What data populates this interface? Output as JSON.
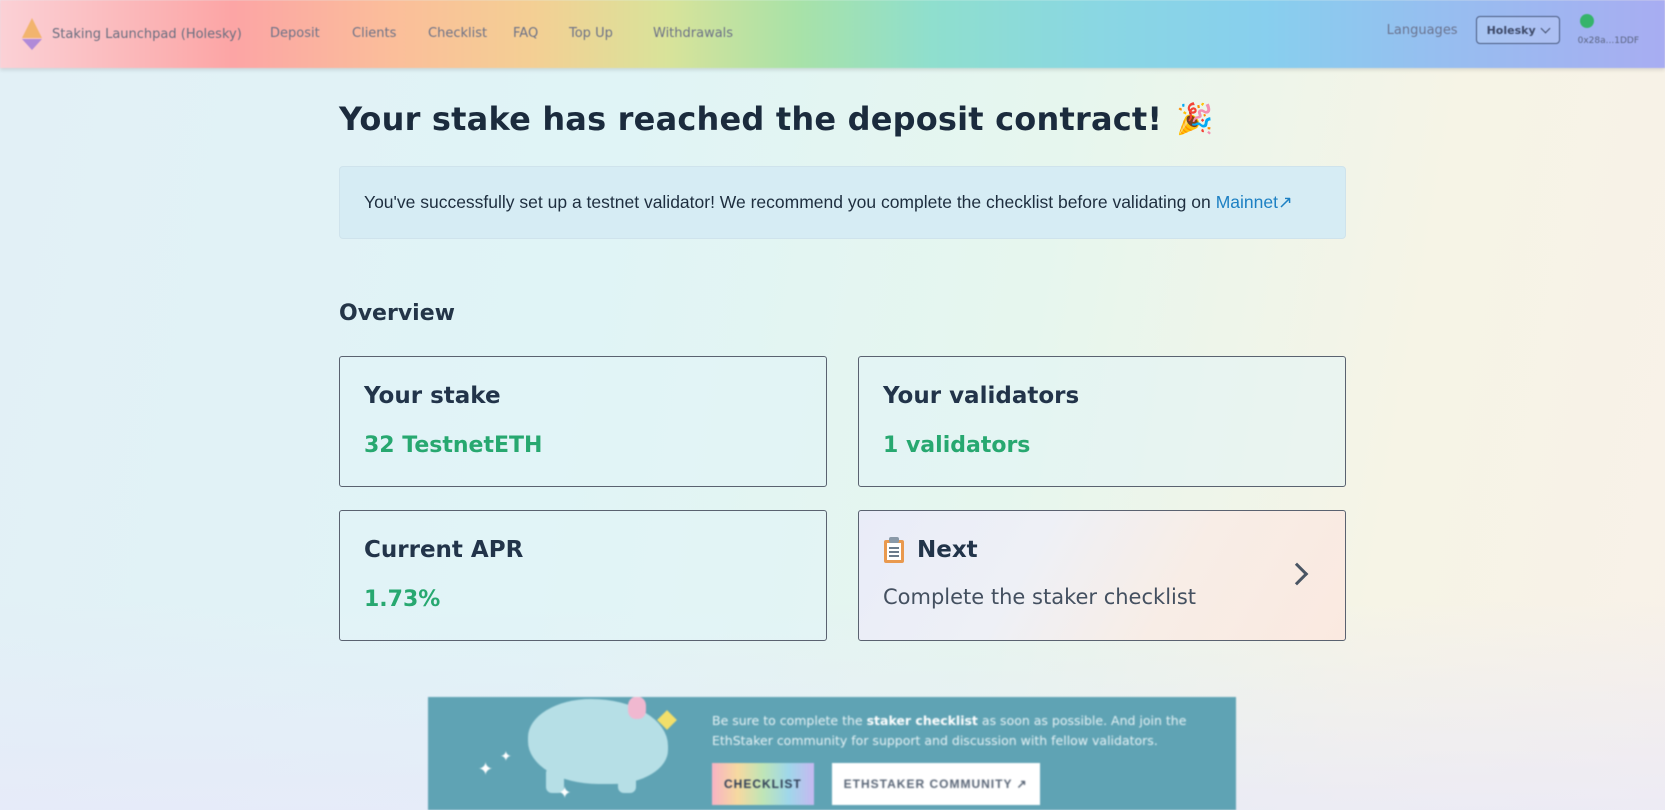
{
  "nav": {
    "brand": "Staking Launchpad (Holesky)",
    "links": [
      "Deposit",
      "Clients",
      "Checklist",
      "FAQ",
      "Top Up",
      "Withdrawals"
    ],
    "languages": "Languages",
    "network": "Holesky",
    "wallet_address": "0x28a...1DDF"
  },
  "main": {
    "title": "Your stake has reached the deposit contract!",
    "title_emoji": "🎉",
    "alert_text": "You've successfully set up a testnet validator! We recommend you complete the checklist before validating on",
    "alert_link": "Mainnet↗",
    "overview_title": "Overview",
    "cards": {
      "stake": {
        "title": "Your stake",
        "value": "32 TestnetETH"
      },
      "validators": {
        "title": "Your validators",
        "value": "1 validators"
      },
      "apr": {
        "title": "Current APR",
        "value": "1.73%"
      },
      "next": {
        "title": "Next",
        "subtitle": "Complete the staker checklist"
      }
    }
  },
  "banner": {
    "text_prefix": "Be sure to complete the",
    "text_bold": "staker checklist",
    "text_suffix": "as soon as possible. And join the EthStaker community for support and discussion with fellow validators.",
    "checklist_button": "CHECKLIST",
    "community_button": "ETHSTAKER COMMUNITY ↗"
  },
  "colors": {
    "accent_green": "#27a870",
    "link_blue": "#1d80c3",
    "banner_bg": "#5fa3b4"
  }
}
